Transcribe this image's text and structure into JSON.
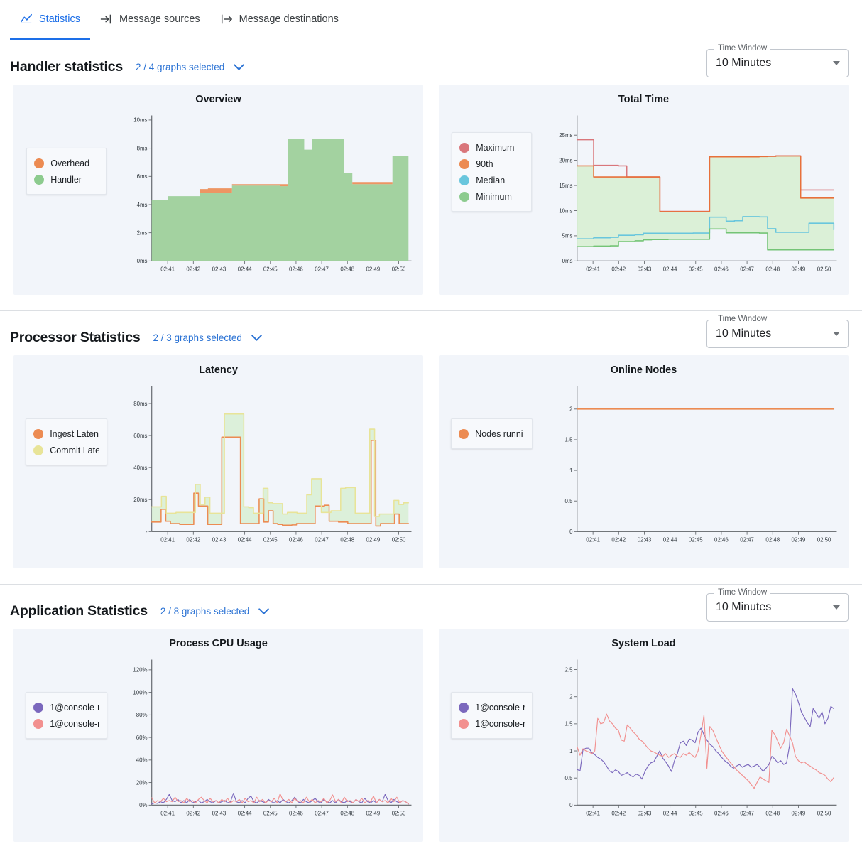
{
  "tabs": [
    {
      "label": "Statistics",
      "icon": "chart-line-icon",
      "active": true
    },
    {
      "label": "Message sources",
      "icon": "arrow-into-bar-icon",
      "active": false
    },
    {
      "label": "Message destinations",
      "icon": "bar-arrow-out-icon",
      "active": false
    }
  ],
  "sections": [
    {
      "title": "Handler statistics",
      "selected": "2 / 4 graphs selected",
      "time_window": {
        "label": "Time Window",
        "value": "10 Minutes"
      }
    },
    {
      "title": "Processor Statistics",
      "selected": "2 / 3 graphs selected",
      "time_window": {
        "label": "Time Window",
        "value": "10 Minutes"
      }
    },
    {
      "title": "Application Statistics",
      "selected": "2 / 8 graphs selected",
      "time_window": {
        "label": "Time Window",
        "value": "10 Minutes"
      }
    }
  ],
  "colors": {
    "accent": "#1d6fe8",
    "link": "#2a72d4",
    "card_bg": "#f2f5fa",
    "orange": "#ec8b52",
    "green": "#8ccb8e",
    "green_fill": "#d8efd3",
    "red": "#d9767b",
    "cyan": "#69c6dd",
    "yellow": "#e8e498",
    "purple": "#7b68bd",
    "pink": "#f2908f"
  },
  "chart_data": [
    {
      "type": "area",
      "title": "Overview",
      "xlabel": "",
      "ylabel": "",
      "ylim": [
        0,
        10
      ],
      "yticks": [
        "0ms",
        "2ms",
        "4ms",
        "6ms",
        "8ms",
        "10ms"
      ],
      "xticks": [
        "02:41",
        "02:42",
        "02:43",
        "02:44",
        "02:45",
        "02:46",
        "02:47",
        "02:48",
        "02:49",
        "02:50"
      ],
      "legend_position": "left",
      "grid": false,
      "series": [
        {
          "name": "Overhead",
          "color": "#ec8b52",
          "values": [
            4.3,
            4.3,
            4.6,
            4.6,
            4.6,
            4.6,
            5.1,
            5.15,
            5.15,
            5.15,
            5.45,
            5.45,
            5.45,
            5.45,
            5.45,
            5.45,
            5.45,
            8.65,
            8.65,
            7.9,
            8.65,
            8.65,
            8.65,
            8.65,
            6.25,
            5.6,
            5.6,
            5.6,
            5.6,
            5.6,
            7.45,
            7.45,
            6.15
          ]
        },
        {
          "name": "Handler",
          "color": "#8ccb8e",
          "values": [
            4.3,
            4.3,
            4.6,
            4.6,
            4.6,
            4.6,
            4.85,
            4.85,
            4.85,
            4.85,
            5.35,
            5.35,
            5.35,
            5.35,
            5.35,
            5.35,
            5.3,
            8.65,
            8.65,
            7.9,
            8.65,
            8.65,
            8.65,
            8.65,
            6.25,
            5.45,
            5.45,
            5.45,
            5.45,
            5.45,
            7.45,
            7.45,
            6.15
          ]
        }
      ]
    },
    {
      "type": "line",
      "title": "Total Time",
      "xlabel": "",
      "ylabel": "",
      "ylim": [
        0,
        28
      ],
      "yticks": [
        "0ms",
        "5ms",
        "10ms",
        "15ms",
        "20ms",
        "25ms"
      ],
      "xticks": [
        "02:41",
        "02:42",
        "02:43",
        "02:44",
        "02:45",
        "02:46",
        "02:47",
        "02:48",
        "02:49",
        "02:50"
      ],
      "legend_position": "left",
      "grid": false,
      "series": [
        {
          "name": "Maximum",
          "color": "#d9767b",
          "values": [
            24.1,
            24.1,
            19.0,
            19.0,
            19.0,
            18.9,
            16.7,
            16.7,
            16.7,
            16.7,
            9.85,
            9.85,
            9.85,
            9.85,
            9.85,
            9.85,
            20.8,
            20.8,
            20.8,
            20.8,
            20.8,
            20.8,
            20.8,
            20.8,
            20.9,
            20.9,
            20.9,
            14.1,
            14.1,
            14.1,
            14.1,
            14.1
          ]
        },
        {
          "name": "90th",
          "color": "#e8703a",
          "values": [
            18.9,
            18.9,
            16.7,
            16.7,
            16.7,
            16.7,
            16.7,
            16.7,
            16.7,
            16.7,
            9.8,
            9.8,
            9.8,
            9.8,
            9.8,
            9.8,
            20.7,
            20.7,
            20.7,
            20.7,
            20.7,
            20.7,
            20.75,
            20.8,
            20.85,
            20.85,
            20.85,
            12.5,
            12.5,
            12.5,
            12.5,
            12.5
          ]
        },
        {
          "name": "Median",
          "color": "#69c6dd",
          "values": [
            4.4,
            4.4,
            4.6,
            4.6,
            4.7,
            5.1,
            5.1,
            5.2,
            5.5,
            5.5,
            5.5,
            5.5,
            5.5,
            5.5,
            5.55,
            5.55,
            8.7,
            8.7,
            7.9,
            8.0,
            8.8,
            8.8,
            8.75,
            6.4,
            5.7,
            5.7,
            5.7,
            5.7,
            7.5,
            7.5,
            7.5,
            6.2
          ]
        },
        {
          "name": "Minimum",
          "color": "#74c476",
          "values": [
            2.85,
            2.85,
            2.95,
            2.95,
            3.0,
            3.85,
            3.85,
            4.0,
            4.2,
            4.25,
            4.25,
            4.3,
            4.3,
            4.3,
            4.3,
            4.3,
            6.35,
            6.35,
            5.6,
            5.6,
            5.6,
            5.6,
            5.55,
            2.2,
            2.2,
            2.2,
            2.2,
            2.2,
            2.2,
            2.2,
            2.2,
            2.2
          ]
        }
      ]
    },
    {
      "type": "area",
      "title": "Latency",
      "xlabel": "",
      "ylabel": "",
      "ylim": [
        0,
        88
      ],
      "yticks": [
        "-",
        "20ms",
        "40ms",
        "60ms",
        "80ms"
      ],
      "xticks": [
        "02:41",
        "02:42",
        "02:43",
        "02:44",
        "02:45",
        "02:46",
        "02:47",
        "02:48",
        "02:49",
        "02:50"
      ],
      "legend_position": "left",
      "grid": false,
      "series": [
        {
          "name": "Ingest Laten",
          "color": "#ec8b52",
          "values": [
            6,
            6,
            14,
            6.5,
            5,
            5,
            4.5,
            4.5,
            4.5,
            24,
            16,
            16,
            4.5,
            4.5,
            4.5,
            59,
            59,
            59,
            59,
            5,
            5,
            5,
            5,
            20.5,
            6,
            13,
            5,
            4.5,
            4,
            4,
            4.2,
            5,
            5,
            5,
            5,
            16,
            16,
            16.5,
            6.5,
            6.5,
            6,
            6,
            5,
            5,
            5,
            5,
            5,
            57,
            3.5,
            5,
            5,
            5,
            11,
            5,
            5,
            5
          ]
        },
        {
          "name": "Commit Late",
          "color": "#e8e498",
          "values": [
            15.5,
            15.5,
            22,
            11.5,
            11.5,
            12,
            12,
            12,
            12,
            29.5,
            17,
            21.5,
            11.5,
            11.5,
            11.5,
            73.5,
            73.5,
            73.5,
            73.5,
            15.5,
            15,
            11.5,
            11.5,
            27,
            18,
            17.5,
            17.5,
            11,
            12,
            12,
            11.5,
            11.5,
            23,
            33,
            33,
            12,
            12,
            13,
            13,
            27,
            27.5,
            27.5,
            11.5,
            11.5,
            11.5,
            64,
            9.5,
            11,
            11,
            11,
            19.5,
            17,
            18,
            18
          ]
        }
      ]
    },
    {
      "type": "line",
      "title": "Online Nodes",
      "xlabel": "",
      "ylabel": "",
      "ylim": [
        0,
        2.3
      ],
      "yticks": [
        "0",
        "0.5",
        "1",
        "1.5",
        "2"
      ],
      "xticks": [
        "02:41",
        "02:42",
        "02:43",
        "02:44",
        "02:45",
        "02:46",
        "02:47",
        "02:48",
        "02:49",
        "02:50"
      ],
      "legend_position": "left",
      "grid": false,
      "series": [
        {
          "name": "Nodes runni",
          "color": "#ec8b52",
          "values": [
            2,
            2,
            2,
            2,
            2,
            2,
            2,
            2,
            2,
            2,
            2,
            2,
            2,
            2,
            2,
            2,
            2,
            2,
            2,
            2
          ]
        }
      ]
    },
    {
      "type": "line",
      "title": "Process CPU Usage",
      "xlabel": "",
      "ylabel": "",
      "ylim": [
        0,
        125
      ],
      "yticks": [
        "0%",
        "20%",
        "40%",
        "60%",
        "80%",
        "100%",
        "120%"
      ],
      "xticks": [
        "02:41",
        "02:42",
        "02:43",
        "02:44",
        "02:45",
        "02:46",
        "02:47",
        "02:48",
        "02:49",
        "02:50"
      ],
      "legend_position": "left",
      "grid": false,
      "series": [
        {
          "name": "1@console-r",
          "color": "#7b68bd",
          "values": [
            1,
            2,
            1.5,
            3,
            2,
            5,
            9.5,
            4,
            3,
            5,
            2,
            4,
            2,
            5,
            2,
            3,
            4,
            2,
            3,
            5,
            3,
            2,
            4,
            2,
            3,
            4,
            2,
            3,
            10.5,
            3,
            2,
            4,
            2,
            6,
            8,
            3,
            2,
            4,
            3,
            2,
            5,
            3,
            2,
            4,
            2,
            5,
            3,
            2,
            4,
            7,
            3,
            2,
            5,
            3,
            2,
            4,
            6,
            3,
            2,
            5,
            3,
            2,
            4,
            2,
            5,
            3,
            2,
            4,
            3,
            2,
            5,
            3,
            2,
            6,
            3,
            2,
            4,
            2,
            5,
            3,
            9.5,
            4,
            2,
            5,
            3,
            2,
            4,
            3,
            1
          ]
        },
        {
          "name": "1@console-r",
          "color": "#f2908f",
          "values": [
            6.5,
            2,
            4,
            3,
            6,
            3,
            4,
            3,
            7,
            3,
            4,
            2,
            6,
            3,
            4,
            2,
            5,
            7,
            4,
            2,
            6,
            3,
            4,
            2,
            5,
            3,
            6,
            2,
            4,
            3,
            5,
            2,
            6,
            3,
            4,
            2,
            7,
            3,
            5,
            2,
            4,
            3,
            6,
            2,
            10,
            4,
            3,
            5,
            2,
            6,
            3,
            4,
            2,
            7,
            3,
            5,
            2,
            4,
            3,
            6,
            2,
            4,
            9,
            3,
            5,
            2,
            7,
            3,
            4,
            2,
            5,
            3,
            6,
            2,
            4,
            3,
            8,
            2,
            5,
            3,
            4,
            2,
            6,
            3,
            7,
            2,
            4,
            3,
            1
          ]
        }
      ]
    },
    {
      "type": "line",
      "title": "System Load",
      "xlabel": "",
      "ylabel": "",
      "ylim": [
        0,
        2.6
      ],
      "yticks": [
        "0",
        "0.5",
        "1",
        "1.5",
        "2",
        "2.5"
      ],
      "xticks": [
        "02:41",
        "02:42",
        "02:43",
        "02:44",
        "02:45",
        "02:46",
        "02:47",
        "02:48",
        "02:49",
        "02:50"
      ],
      "legend_position": "left",
      "grid": false,
      "series": [
        {
          "name": "1@console-r",
          "color": "#7b68bd",
          "values": [
            0.66,
            0.63,
            1.02,
            1.05,
            1.05,
            0.97,
            0.93,
            0.88,
            0.85,
            0.8,
            0.72,
            0.63,
            0.6,
            0.65,
            0.62,
            0.55,
            0.57,
            0.6,
            0.55,
            0.52,
            0.57,
            0.55,
            0.48,
            0.62,
            0.72,
            0.78,
            0.8,
            0.9,
            1.0,
            0.87,
            0.8,
            0.72,
            0.62,
            0.82,
            0.95,
            1.15,
            1.18,
            1.1,
            1.22,
            1.2,
            1.15,
            1.35,
            1.42,
            1.3,
            1.2,
            1.12,
            1.08,
            1.0,
            0.95,
            0.88,
            0.82,
            0.78,
            0.72,
            0.68,
            0.72,
            0.75,
            0.7,
            0.73,
            0.75,
            0.7,
            0.72,
            0.75,
            0.7,
            0.62,
            0.68,
            0.75,
            0.9,
            0.85,
            0.78,
            0.82,
            0.75,
            0.78,
            1.1,
            2.15,
            2.05,
            1.9,
            1.72,
            1.62,
            1.52,
            1.45,
            1.78,
            1.7,
            1.6,
            1.72,
            1.5,
            1.6,
            1.82,
            1.78
          ]
        },
        {
          "name": "1@console-r",
          "color": "#f2908f",
          "values": [
            1.08,
            0.92,
            1.04,
            1.0,
            0.98,
            0.95,
            1.0,
            1.6,
            1.5,
            1.52,
            1.68,
            1.55,
            1.5,
            1.42,
            1.38,
            1.2,
            1.18,
            1.48,
            1.42,
            1.35,
            1.3,
            1.22,
            1.18,
            1.12,
            1.05,
            1.0,
            0.98,
            0.95,
            0.92,
            0.9,
            0.95,
            0.88,
            0.92,
            0.95,
            0.9,
            0.88,
            0.95,
            0.92,
            0.97,
            0.92,
            0.88,
            1.0,
            1.3,
            1.66,
            0.68,
            1.45,
            1.38,
            1.25,
            1.12,
            1.0,
            0.92,
            0.85,
            0.78,
            0.72,
            0.65,
            0.6,
            0.55,
            0.5,
            0.45,
            0.38,
            0.31,
            0.42,
            0.52,
            0.48,
            0.45,
            0.42,
            1.38,
            1.3,
            1.18,
            1.05,
            1.15,
            1.4,
            1.28,
            1.15,
            0.9,
            0.82,
            0.78,
            0.8,
            0.75,
            0.72,
            0.68,
            0.65,
            0.6,
            0.58,
            0.55,
            0.48,
            0.43,
            0.51
          ]
        }
      ]
    }
  ]
}
